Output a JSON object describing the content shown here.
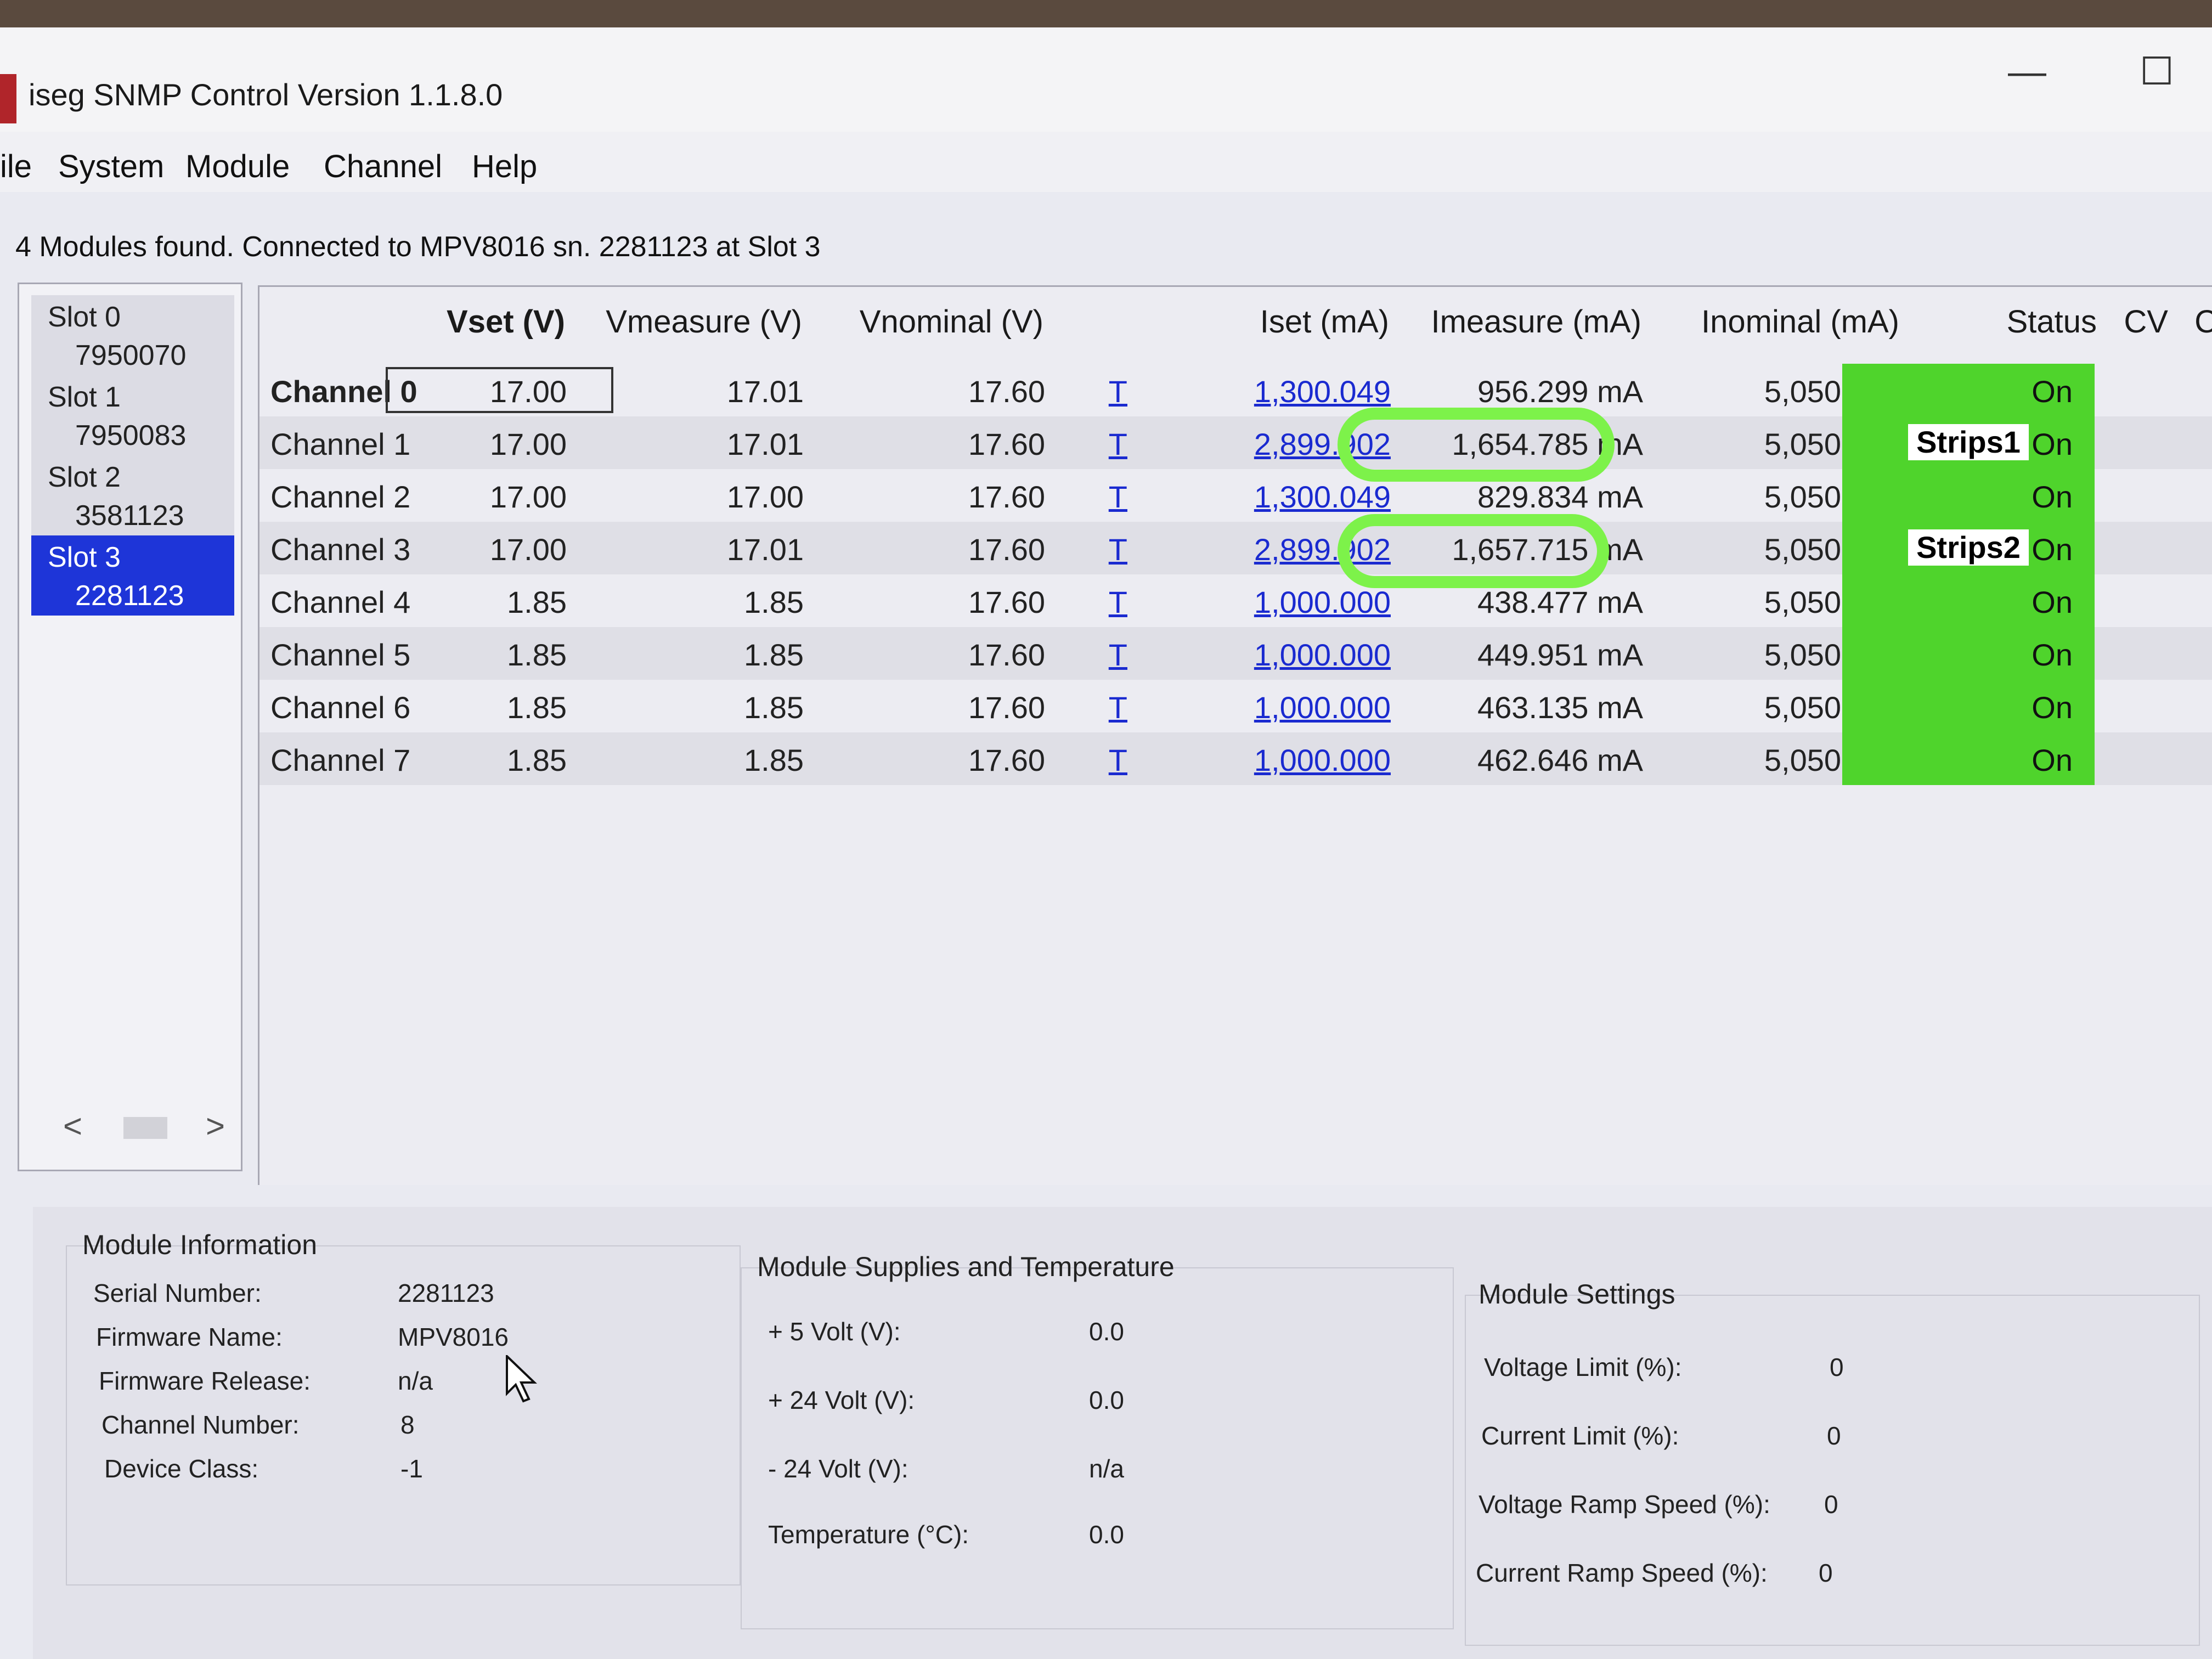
{
  "window": {
    "title": "iseg SNMP Control Version 1.1.8.0",
    "minimize_glyph": "—",
    "maximize_glyph": "☐"
  },
  "menu": [
    "ile",
    "System",
    "Module",
    "Channel",
    "Help"
  ],
  "status_line": "4 Modules found.  Connected to MPV8016 sn. 2281123 at Slot 3",
  "slots": [
    {
      "name": "Slot 0",
      "serial": "7950070",
      "selected": false
    },
    {
      "name": "Slot 1",
      "serial": "7950083",
      "selected": false
    },
    {
      "name": "Slot 2",
      "serial": "3581123",
      "selected": false
    },
    {
      "name": "Slot 3",
      "serial": "2281123",
      "selected": true
    }
  ],
  "slot_scroll": {
    "left": "<",
    "right": ">"
  },
  "grid": {
    "headers": {
      "vset": "Vset (V)",
      "vmeasure": "Vmeasure (V)",
      "vnominal": "Vnominal (V)",
      "iset": "Iset (mA)",
      "imeasure": "Imeasure (mA)",
      "inominal": "Inominal (mA)",
      "status": "Status",
      "cv": "CV",
      "c": "C"
    },
    "rows": [
      {
        "channel": "Channel 0",
        "vset": "17.00",
        "vmeasure": "17.01",
        "vnominal": "17.60",
        "t": "T",
        "iset": "1,300.049",
        "imeasure": "956.299 mA",
        "inominal": "5,050.049",
        "status": "On",
        "label": ""
      },
      {
        "channel": "Channel 1",
        "vset": "17.00",
        "vmeasure": "17.01",
        "vnominal": "17.60",
        "t": "T",
        "iset": "2,899.902",
        "imeasure": "1,654.785 mA",
        "inominal": "5,050.049",
        "status": "On",
        "label": "Strips1"
      },
      {
        "channel": "Channel 2",
        "vset": "17.00",
        "vmeasure": "17.00",
        "vnominal": "17.60",
        "t": "T",
        "iset": "1,300.049",
        "imeasure": "829.834 mA",
        "inominal": "5,050.049",
        "status": "On",
        "label": ""
      },
      {
        "channel": "Channel 3",
        "vset": "17.00",
        "vmeasure": "17.01",
        "vnominal": "17.60",
        "t": "T",
        "iset": "2,899.902",
        "imeasure": "1,657.715 mA",
        "inominal": "5,050.049",
        "status": "On",
        "label": "Strips2"
      },
      {
        "channel": "Channel 4",
        "vset": "1.85",
        "vmeasure": "1.85",
        "vnominal": "17.60",
        "t": "T",
        "iset": "1,000.000",
        "imeasure": "438.477 mA",
        "inominal": "5,050.049",
        "status": "On",
        "label": ""
      },
      {
        "channel": "Channel 5",
        "vset": "1.85",
        "vmeasure": "1.85",
        "vnominal": "17.60",
        "t": "T",
        "iset": "1,000.000",
        "imeasure": "449.951 mA",
        "inominal": "5,050.049",
        "status": "On",
        "label": ""
      },
      {
        "channel": "Channel 6",
        "vset": "1.85",
        "vmeasure": "1.85",
        "vnominal": "17.60",
        "t": "T",
        "iset": "1,000.000",
        "imeasure": "463.135 mA",
        "inominal": "5,050.049",
        "status": "On",
        "label": ""
      },
      {
        "channel": "Channel 7",
        "vset": "1.85",
        "vmeasure": "1.85",
        "vnominal": "17.60",
        "t": "T",
        "iset": "1,000.000",
        "imeasure": "462.646 mA",
        "inominal": "5,050.049",
        "status": "On",
        "label": ""
      }
    ]
  },
  "module_info": {
    "title": "Module Information",
    "serial_label": "Serial Number:",
    "serial": "2281123",
    "fw_name_label": "Firmware Name:",
    "fw_name": "MPV8016",
    "fw_release_label": "Firmware Release:",
    "fw_release": "n/a",
    "channels_label": "Channel Number:",
    "channels": "8",
    "class_label": "Device Class:",
    "class": "-1"
  },
  "supplies": {
    "title": "Module Supplies and Temperature",
    "p5_label": "+ 5 Volt (V):",
    "p5": "0.0",
    "p24_label": "+ 24 Volt (V):",
    "p24": "0.0",
    "m24_label": "- 24 Volt (V):",
    "m24": "n/a",
    "temp_label": "Temperature (°C):",
    "temp": "0.0"
  },
  "settings": {
    "title": "Module Settings",
    "vlimit_label": "Voltage Limit (%):",
    "vlimit": "0",
    "ilimit_label": "Current Limit (%):",
    "ilimit": "0",
    "vramp_label": "Voltage Ramp Speed (%):",
    "vramp": "0",
    "iramp_label": "Current Ramp Speed (%):",
    "iramp": "0"
  },
  "colors": {
    "status_on": "#4fd42c",
    "highlight_ring": "#7df24a",
    "selected_slot": "#1e35d8",
    "link_blue": "#1a2ad0"
  }
}
